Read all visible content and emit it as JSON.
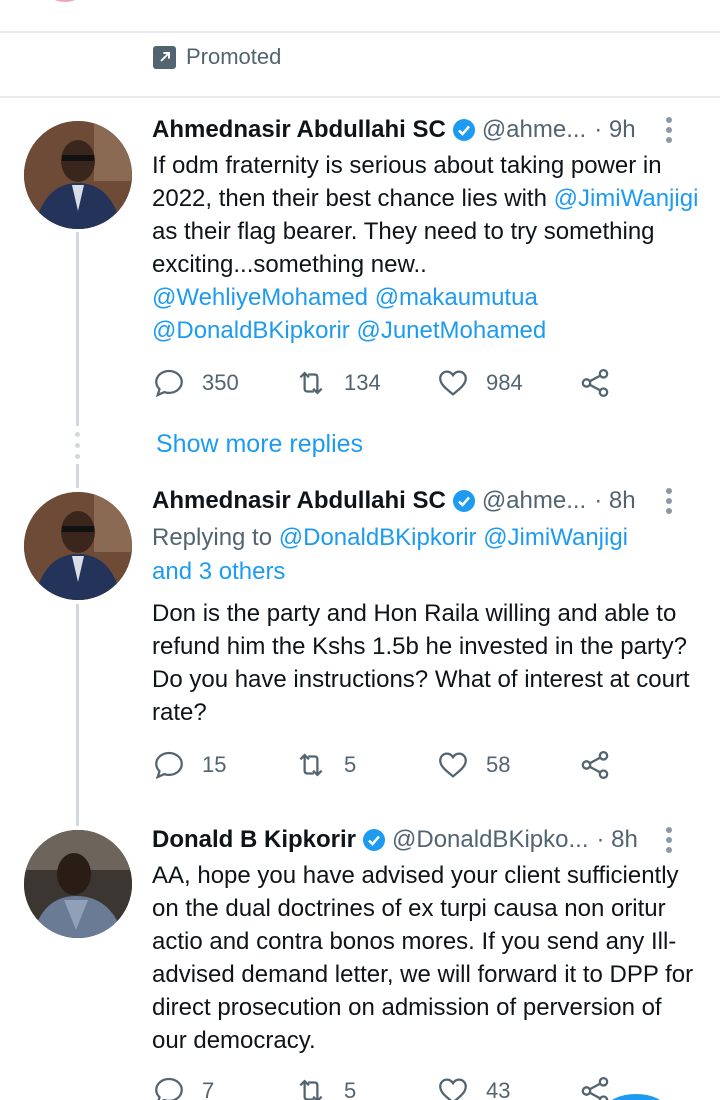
{
  "promoted_label": "Promoted",
  "show_more_replies": "Show more replies",
  "tweets": [
    {
      "name": "Ahmednasir Abdullahi SC",
      "handle": "@ahme...",
      "time": "· 9h",
      "text_parts": [
        "If odm fraternity is serious about taking power in 2022, then their best chance lies with ",
        "@JimiWanjigi",
        " as their flag bearer. They need to try something exciting...something new.. ",
        "@WehliyeMohamed",
        "@makaumutua",
        "@DonaldBKipkorir",
        "@JunetMohamed"
      ],
      "replies": "350",
      "retweets": "134",
      "likes": "984"
    },
    {
      "name": "Ahmednasir Abdullahi SC",
      "handle": "@ahme...",
      "time": "· 8h",
      "replying_to_label": "Replying to",
      "replying_to_users": "@DonaldBKipkorir @JimiWanjigi",
      "replying_to_others": "and 3 others",
      "text": "Don is the party and Hon Raila willing and able to refund him the Kshs 1.5b he invested in the party? Do you have instructions? What of interest at court rate?",
      "replies": "15",
      "retweets": "5",
      "likes": "58"
    },
    {
      "name": "Donald B Kipkorir",
      "handle": "@DonaldBKipko...",
      "time": "· 8h",
      "text": "AA, hope you have advised your client sufficiently on the dual doctrines of ex turpi causa non oritur actio and contra bonos mores. If you send any Ill-advised demand letter, we will forward it to DPP for direct prosecution on admission of perversion of our democracy.",
      "replies": "7",
      "retweets": "5",
      "likes": "43"
    }
  ],
  "colors": {
    "link": "#1d9bf0",
    "muted": "#536471",
    "thread_line": "#cfd9de"
  }
}
